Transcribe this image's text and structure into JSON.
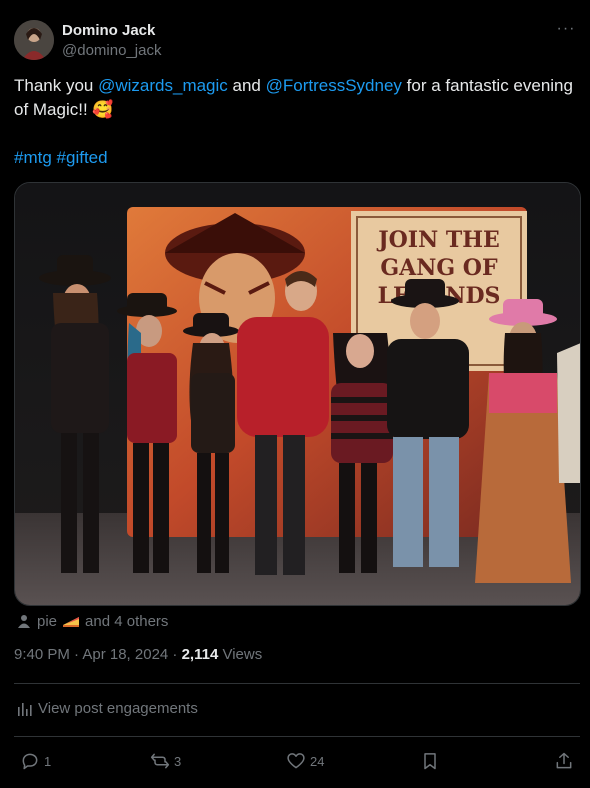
{
  "author": {
    "display_name": "Domino Jack",
    "handle": "@domino_jack"
  },
  "post": {
    "text_prefix": "Thank you ",
    "mention_1": "@wizards_magic",
    "text_and": " and ",
    "mention_2": "@FortressSydney",
    "text_suffix": " for a fantastic evening of Magic!! 🥰",
    "hashtag_1": "#mtg",
    "hashtag_2": "#gifted"
  },
  "photo": {
    "sign_text_line1": "JOIN THE",
    "sign_text_line2": "GANG OF",
    "sign_text_line3": "LEGENDS"
  },
  "likes": {
    "liker": "pie",
    "others": "and 4 others"
  },
  "meta": {
    "timestamp": "9:40 PM · Apr 18, 2024 · ",
    "views_count": "2,114",
    "views_label": " Views"
  },
  "engagements_label": "View post engagements",
  "actions": {
    "replies": "1",
    "reposts": "3",
    "likes": "24"
  },
  "colors": {
    "accent": "#1d9bf0",
    "muted": "#71767b",
    "divider": "#2f3336"
  }
}
